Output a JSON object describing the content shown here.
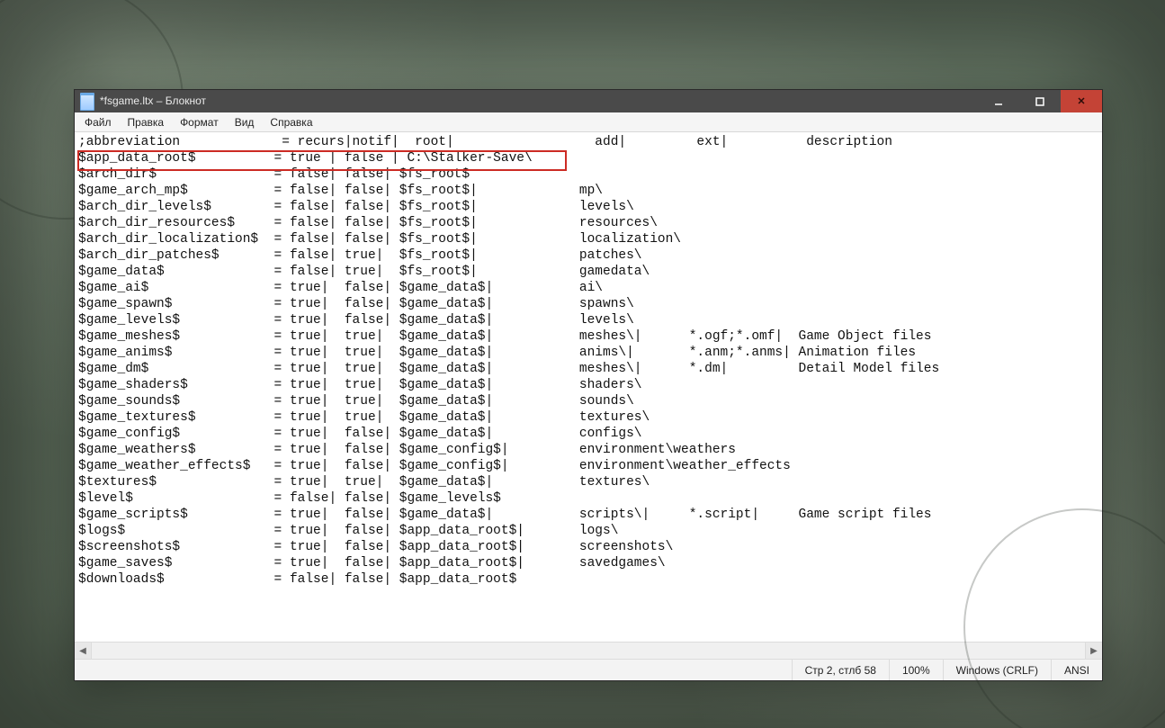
{
  "window": {
    "title": "*fsgame.ltx – Блокнот"
  },
  "menu": {
    "file": "Файл",
    "edit": "Правка",
    "format": "Формат",
    "view": "Вид",
    "help": "Справка"
  },
  "editor": {
    "lines": [
      ";abbreviation             = recurs|notif|  root|                  add|         ext|          description",
      "$app_data_root$          = true | false | C:\\Stalker-Save\\",
      "$arch_dir$               = false| false| $fs_root$",
      "$game_arch_mp$           = false| false| $fs_root$|             mp\\",
      "$arch_dir_levels$        = false| false| $fs_root$|             levels\\",
      "$arch_dir_resources$     = false| false| $fs_root$|             resources\\",
      "$arch_dir_localization$  = false| false| $fs_root$|             localization\\",
      "$arch_dir_patches$       = false| true|  $fs_root$|             patches\\",
      "$game_data$              = false| true|  $fs_root$|             gamedata\\",
      "$game_ai$                = true|  false| $game_data$|           ai\\",
      "$game_spawn$             = true|  false| $game_data$|           spawns\\",
      "$game_levels$            = true|  false| $game_data$|           levels\\",
      "$game_meshes$            = true|  true|  $game_data$|           meshes\\|      *.ogf;*.omf|  Game Object files",
      "$game_anims$             = true|  true|  $game_data$|           anims\\|       *.anm;*.anms| Animation files",
      "$game_dm$                = true|  true|  $game_data$|           meshes\\|      *.dm|         Detail Model files",
      "$game_shaders$           = true|  true|  $game_data$|           shaders\\",
      "$game_sounds$            = true|  true|  $game_data$|           sounds\\",
      "$game_textures$          = true|  true|  $game_data$|           textures\\",
      "$game_config$            = true|  false| $game_data$|           configs\\",
      "$game_weathers$          = true|  false| $game_config$|         environment\\weathers",
      "$game_weather_effects$   = true|  false| $game_config$|         environment\\weather_effects",
      "$textures$               = true|  true|  $game_data$|           textures\\",
      "$level$                  = false| false| $game_levels$",
      "$game_scripts$           = true|  false| $game_data$|           scripts\\|     *.script|     Game script files",
      "$logs$                   = true|  false| $app_data_root$|       logs\\",
      "$screenshots$            = true|  false| $app_data_root$|       screenshots\\",
      "$game_saves$             = true|  false| $app_data_root$|       savedgames\\",
      "$downloads$              = false| false| $app_data_root$"
    ]
  },
  "scroll": {
    "left_glyph": "◀",
    "right_glyph": "▶"
  },
  "status": {
    "position": "Стр 2, стлб 58",
    "zoom": "100%",
    "eol": "Windows (CRLF)",
    "encoding": "ANSI"
  }
}
